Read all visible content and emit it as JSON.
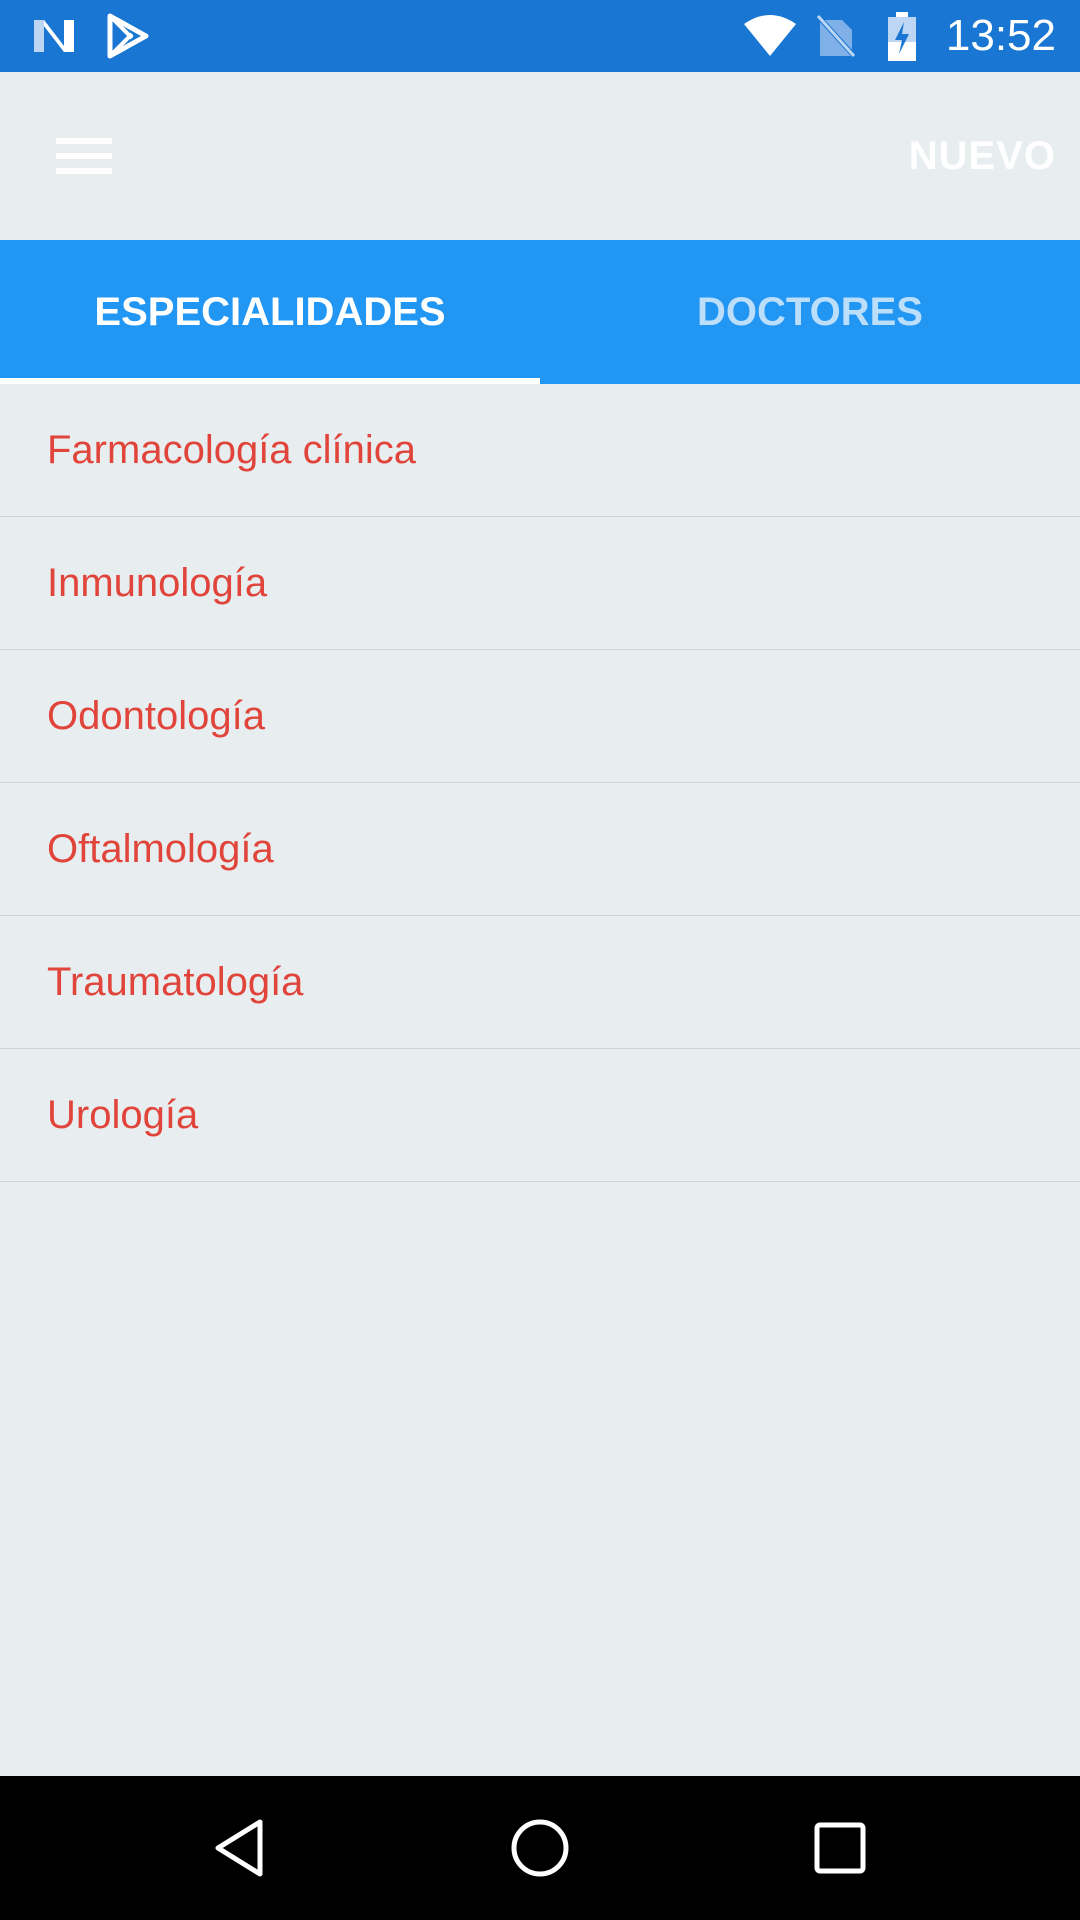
{
  "status_bar": {
    "time": "13:52",
    "icons": [
      "n-notification-icon",
      "play-store-icon",
      "wifi-icon",
      "no-sim-icon",
      "battery-charging-icon"
    ]
  },
  "app_bar": {
    "menu_icon": "menu-icon",
    "action_label": "NUEVO"
  },
  "tabs": [
    {
      "label": "ESPECIALIDADES",
      "selected": true
    },
    {
      "label": "DOCTORES",
      "selected": false
    }
  ],
  "specialties": [
    {
      "label": "Farmacología clínica"
    },
    {
      "label": "Inmunología"
    },
    {
      "label": "Odontología"
    },
    {
      "label": "Oftalmología"
    },
    {
      "label": "Traumatología"
    },
    {
      "label": "Urología"
    }
  ],
  "nav_bar": {
    "icons": [
      "back-icon",
      "home-icon",
      "recents-icon"
    ]
  },
  "colors": {
    "status_bar": "#1976d2",
    "tab_bar": "#2196f3",
    "item_text": "#e0443a",
    "background": "#e8eef0"
  }
}
